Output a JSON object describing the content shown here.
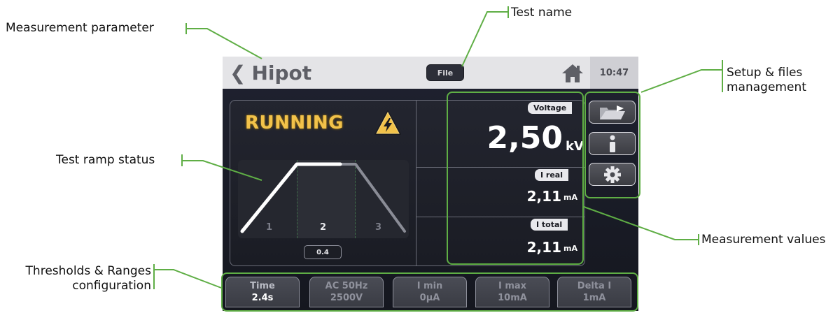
{
  "callouts": {
    "measurement_parameter": "Measurement parameter",
    "test_name": "Test name",
    "setup_files_management": "Setup & files management",
    "test_ramp_status": "Test ramp status",
    "measurement_values": "Measurement values",
    "thresholds_ranges": "Thresholds & Ranges configuration"
  },
  "topbar": {
    "back_chevron": "❮",
    "title": "Hipot",
    "file_label": "File",
    "clock": "10:47"
  },
  "status": {
    "state": "RUNNING",
    "steps": [
      "1",
      "2",
      "3"
    ],
    "active_step": 2,
    "step_time": "0.4"
  },
  "measurements": {
    "voltage": {
      "label": "Voltage",
      "value": "2,50",
      "unit": "kV"
    },
    "i_real": {
      "label": "I real",
      "value": "2,11",
      "unit": "mA"
    },
    "i_total": {
      "label": "I total",
      "value": "2,11",
      "unit": "mA"
    }
  },
  "side_buttons": [
    "folder-icon",
    "info-icon",
    "gear-icon"
  ],
  "bottom_buttons": [
    {
      "line1": "Time",
      "line2": "2.4s"
    },
    {
      "line1": "AC 50Hz",
      "line2": "2500V"
    },
    {
      "line1": "I min",
      "line2": "0µA"
    },
    {
      "line1": "I max",
      "line2": "10mA"
    },
    {
      "line1": "Delta I",
      "line2": "1mA"
    }
  ],
  "colors": {
    "callout_green": "#5fae45",
    "running_amber": "#f2c24a",
    "screen_bg": "#1f2230",
    "topbar_bg": "#e4e4e7"
  }
}
